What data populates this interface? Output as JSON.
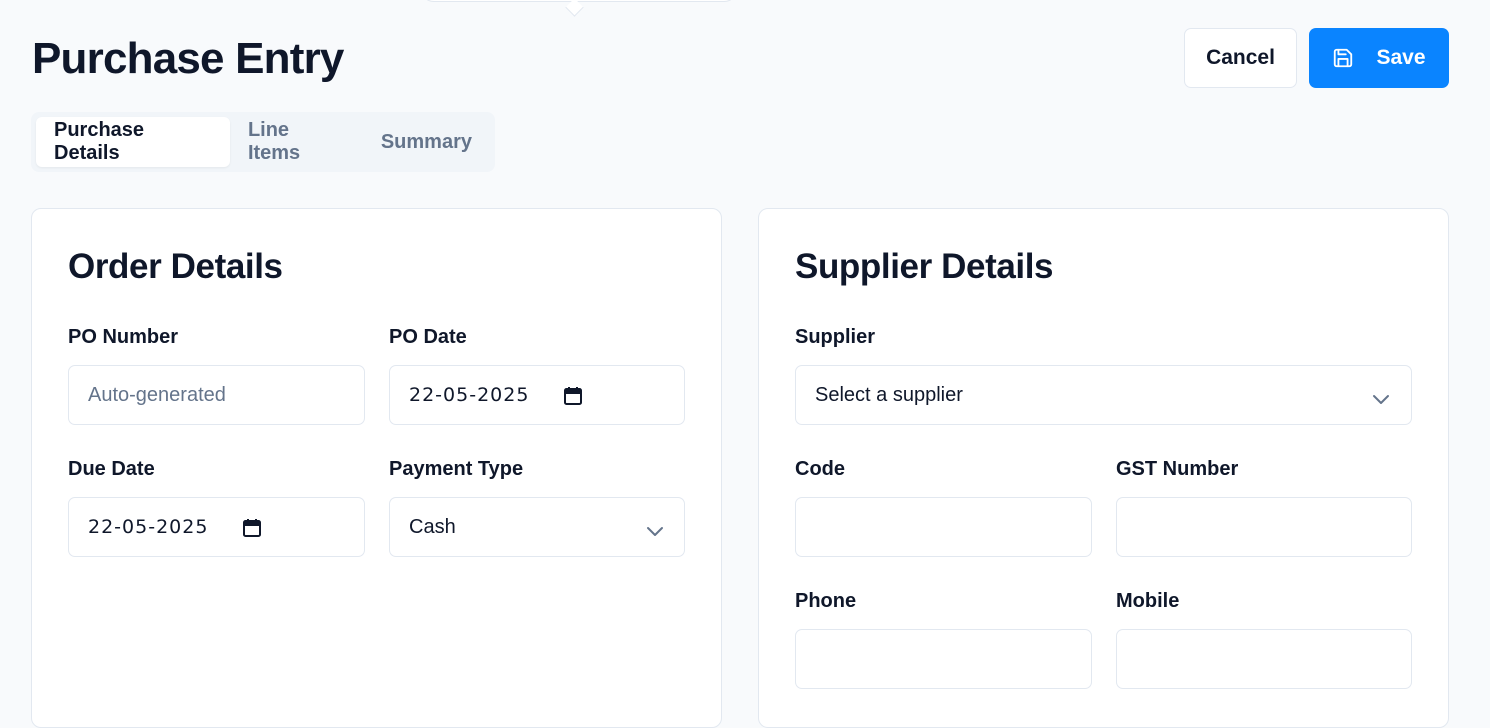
{
  "page": {
    "title": "Purchase Entry"
  },
  "actions": {
    "cancel_label": "Cancel",
    "save_label": "Save"
  },
  "tabs": [
    {
      "label": "Purchase Details",
      "active": true
    },
    {
      "label": "Line Items",
      "active": false
    },
    {
      "label": "Summary",
      "active": false
    }
  ],
  "order_details": {
    "title": "Order Details",
    "po_number": {
      "label": "PO Number",
      "placeholder": "Auto-generated",
      "value": ""
    },
    "po_date": {
      "label": "PO Date",
      "value": "22-05-2025"
    },
    "due_date": {
      "label": "Due Date",
      "value": "22-05-2025"
    },
    "payment_type": {
      "label": "Payment Type",
      "value": "Cash"
    }
  },
  "supplier_details": {
    "title": "Supplier Details",
    "supplier": {
      "label": "Supplier",
      "value": "Select a supplier"
    },
    "code": {
      "label": "Code",
      "value": ""
    },
    "gst_number": {
      "label": "GST Number",
      "value": ""
    },
    "phone": {
      "label": "Phone",
      "value": ""
    },
    "mobile": {
      "label": "Mobile",
      "value": ""
    }
  },
  "icons": {
    "save": "floppy-disk-icon",
    "calendar": "calendar-icon",
    "dropdown": "chevron-down-icon"
  },
  "colors": {
    "accent": "#0a84ff",
    "background": "#f8fafc",
    "muted_text": "#64748b",
    "border": "#e2e8f0"
  }
}
